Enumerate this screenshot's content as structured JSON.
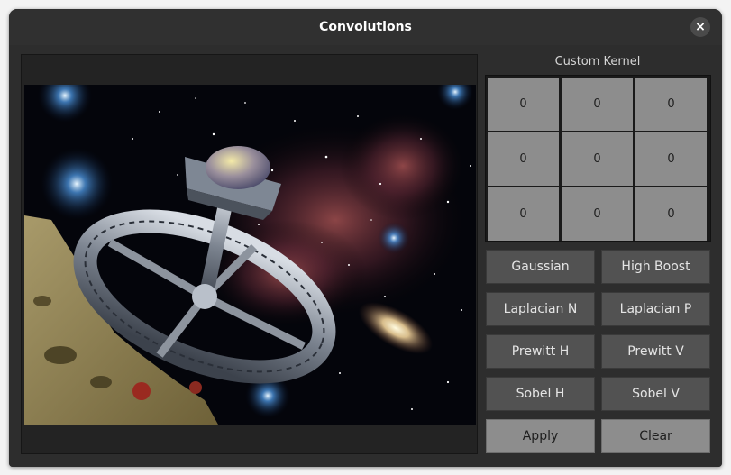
{
  "window": {
    "title": "Convolutions",
    "close_label": "×"
  },
  "kernel": {
    "label": "Custom Kernel",
    "cells": [
      "0",
      "0",
      "0",
      "0",
      "0",
      "0",
      "0",
      "0",
      "0"
    ]
  },
  "presets": {
    "gaussian": "Gaussian",
    "high_boost": "High Boost",
    "laplacian_n": "Laplacian N",
    "laplacian_p": "Laplacian P",
    "prewitt_h": "Prewitt H",
    "prewitt_v": "Prewitt V",
    "sobel_h": "Sobel H",
    "sobel_v": "Sobel V"
  },
  "actions": {
    "apply": "Apply",
    "clear": "Clear"
  },
  "colors": {
    "window_bg": "#2f2f2f",
    "kernel_cell": "#8d8d8d",
    "preset_button": "#525252",
    "action_button": "#8d8d8d"
  }
}
